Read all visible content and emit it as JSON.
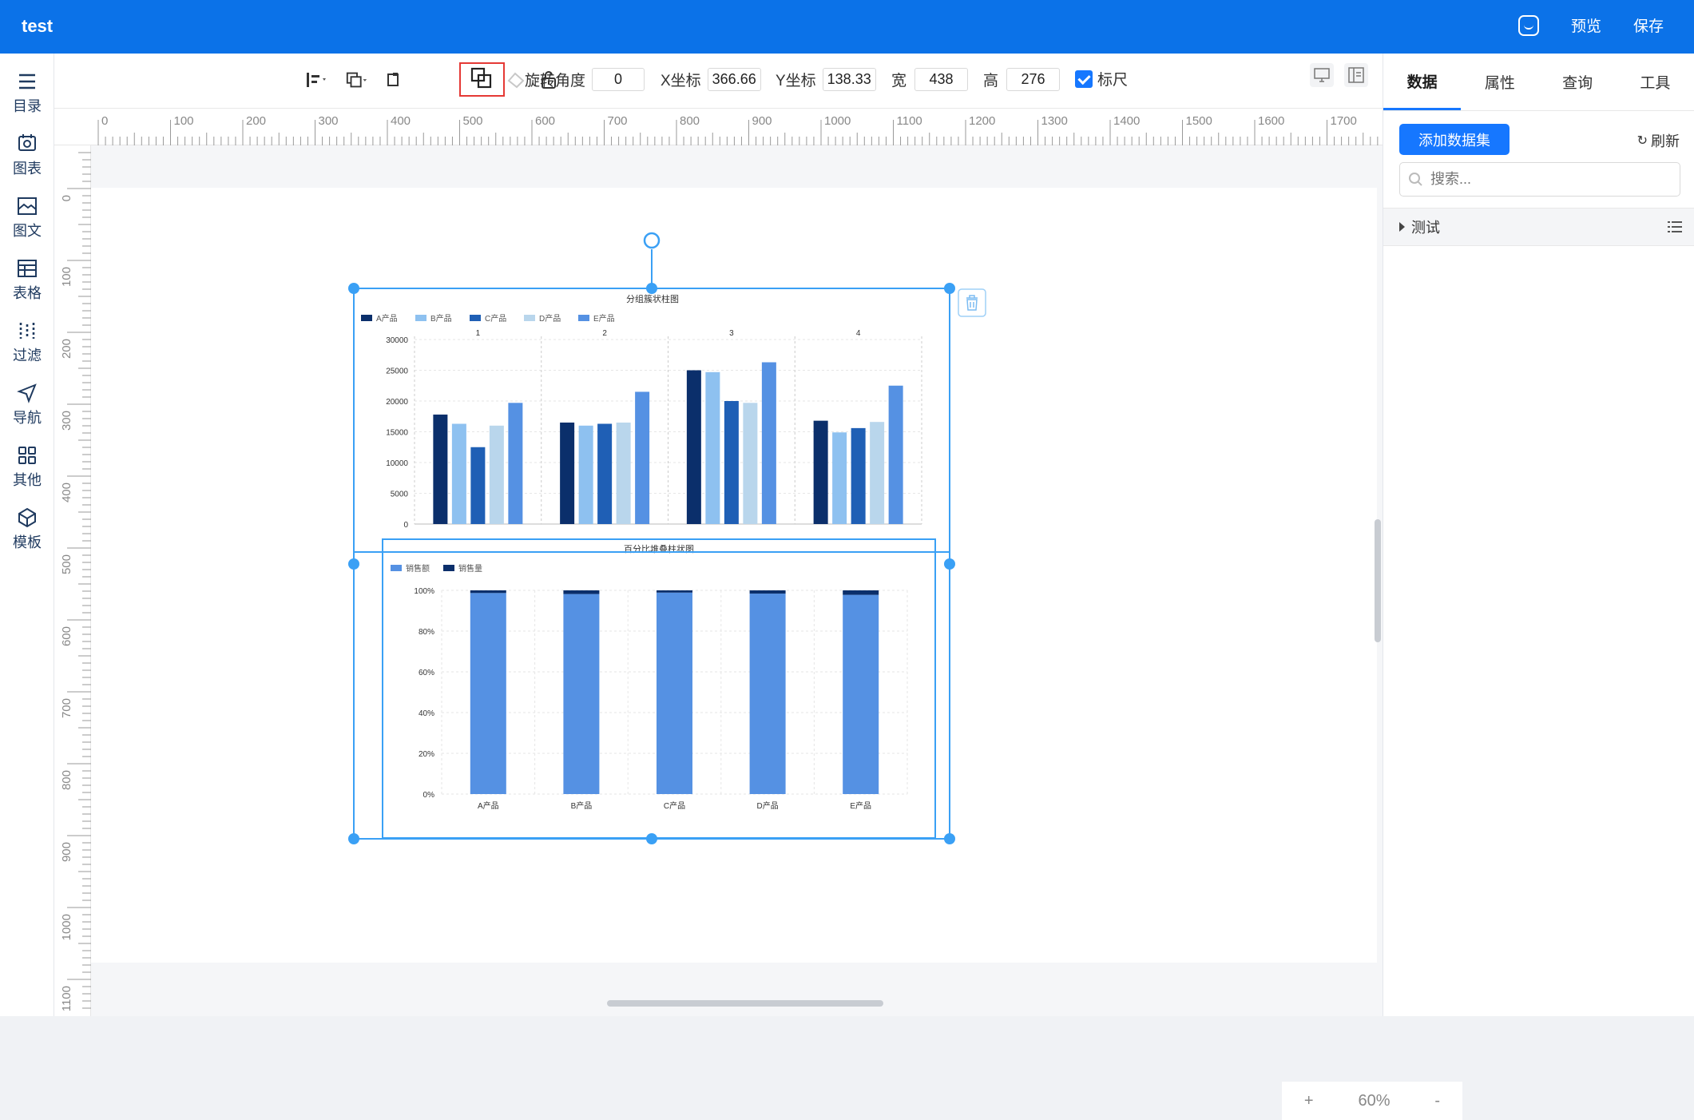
{
  "header": {
    "title": "test",
    "preview_label": "预览",
    "save_label": "保存"
  },
  "leftnav": [
    {
      "label": "目录",
      "icon": "list-icon"
    },
    {
      "label": "图表",
      "icon": "chart-icon"
    },
    {
      "label": "图文",
      "icon": "image-icon"
    },
    {
      "label": "表格",
      "icon": "table-icon"
    },
    {
      "label": "过滤",
      "icon": "filter-icon"
    },
    {
      "label": "导航",
      "icon": "navigate-icon"
    },
    {
      "label": "其他",
      "icon": "grid-icon"
    },
    {
      "label": "模板",
      "icon": "template-icon"
    }
  ],
  "toolbar": {
    "rotate_label": "旋转角度",
    "rotate_value": "0",
    "x_label": "X坐标",
    "x_value": "366.66",
    "y_label": "Y坐标",
    "y_value": "138.33",
    "width_label": "宽",
    "width_value": "438",
    "height_label": "高",
    "height_value": "276",
    "ruler_label": "标尺",
    "ruler_checked": true
  },
  "ruler": {
    "h_labels": [
      "0",
      "100",
      "200",
      "300",
      "400",
      "500",
      "600",
      "700",
      "800",
      "900",
      "1000",
      "1100",
      "1200",
      "1300",
      "1400",
      "1500",
      "1600",
      "1700"
    ],
    "v_labels": [
      "0",
      "100",
      "200",
      "300",
      "400",
      "500",
      "600",
      "700",
      "800",
      "900",
      "1000",
      "1100"
    ]
  },
  "rightpanel": {
    "tabs": [
      "数据",
      "属性",
      "查询",
      "工具"
    ],
    "active_tab": "数据",
    "add_dataset_label": "添加数据集",
    "refresh_label": "刷新",
    "search_placeholder": "搜索...",
    "tree_item": "测试"
  },
  "zoom": {
    "plus": "+",
    "value": "60%",
    "minus": "-"
  },
  "chart_data": [
    {
      "type": "bar",
      "title": "分组簇状柱图",
      "groups": [
        "1",
        "2",
        "3",
        "4"
      ],
      "series": [
        {
          "name": "A产品",
          "color": "#0b2f6b",
          "values": [
            17800,
            16500,
            25000,
            16800
          ]
        },
        {
          "name": "B产品",
          "color": "#8ec1f0",
          "values": [
            16300,
            16000,
            24700,
            14900
          ]
        },
        {
          "name": "C产品",
          "color": "#1f5fb5",
          "values": [
            12500,
            16300,
            20000,
            15600
          ]
        },
        {
          "name": "D产品",
          "color": "#b9d6ec",
          "values": [
            16000,
            16500,
            19700,
            16600
          ]
        },
        {
          "name": "E产品",
          "color": "#5591e3",
          "values": [
            19700,
            21500,
            26300,
            22500
          ]
        }
      ],
      "yticks": [
        "0",
        "5000",
        "10000",
        "15000",
        "20000",
        "25000",
        "30000"
      ],
      "ylim": [
        0,
        30000
      ]
    },
    {
      "type": "bar",
      "title": "百分比堆叠柱状图",
      "categories": [
        "A产品",
        "B产品",
        "C产品",
        "D产品",
        "E产品"
      ],
      "series": [
        {
          "name": "销售额",
          "color": "#5591e3",
          "values": [
            98.7,
            98.2,
            98.9,
            98.4,
            97.8
          ]
        },
        {
          "name": "销售量",
          "color": "#0b2f6b",
          "values": [
            1.3,
            1.8,
            1.1,
            1.6,
            2.2
          ]
        }
      ],
      "yticks": [
        "0%",
        "20%",
        "40%",
        "60%",
        "80%",
        "100%"
      ],
      "ylim": [
        0,
        100
      ]
    }
  ]
}
